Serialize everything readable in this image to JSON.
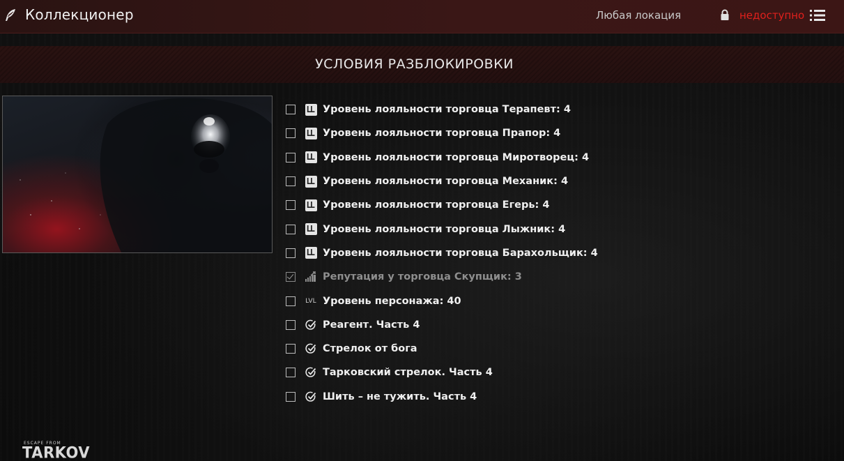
{
  "header": {
    "quest_title": "Коллекционер",
    "location": "Любая локация",
    "status": "недоступно",
    "status_color": "#e0201c"
  },
  "conditions": {
    "title": "УСЛОВИЯ РАЗБЛОКИРОВКИ",
    "items": [
      {
        "icon": "loyalty-level-icon",
        "label": "Уровень лояльности торговца Терапевт: 4",
        "checked": false
      },
      {
        "icon": "loyalty-level-icon",
        "label": "Уровень лояльности торговца Прапор: 4",
        "checked": false
      },
      {
        "icon": "loyalty-level-icon",
        "label": "Уровень лояльности торговца Миротворец: 4",
        "checked": false
      },
      {
        "icon": "loyalty-level-icon",
        "label": "Уровень лояльности торговца Механик: 4",
        "checked": false
      },
      {
        "icon": "loyalty-level-icon",
        "label": "Уровень лояльности торговца Егерь: 4",
        "checked": false
      },
      {
        "icon": "loyalty-level-icon",
        "label": "Уровень лояльности торговца Лыжник: 4",
        "checked": false
      },
      {
        "icon": "loyalty-level-icon",
        "label": "Уровень лояльности торговца Барахольщик: 4",
        "checked": false
      },
      {
        "icon": "reputation-icon",
        "label": "Репутация у торговца Скупщик: 3",
        "checked": true
      },
      {
        "icon": "level-icon",
        "icon_text": "LVL",
        "label": "Уровень персонажа: 40",
        "checked": false
      },
      {
        "icon": "quest-complete-icon",
        "label": "Реагент. Часть 4",
        "checked": false
      },
      {
        "icon": "quest-complete-icon",
        "label": "Стрелок от бога",
        "checked": false
      },
      {
        "icon": "quest-complete-icon",
        "label": "Тарковский стрелок. Часть 4",
        "checked": false
      },
      {
        "icon": "quest-complete-icon",
        "label": "Шить – не тужить. Часть 4",
        "checked": false
      }
    ]
  },
  "logo": {
    "small_text": "ESCAPE FROM",
    "main_text": "TARKOV"
  }
}
